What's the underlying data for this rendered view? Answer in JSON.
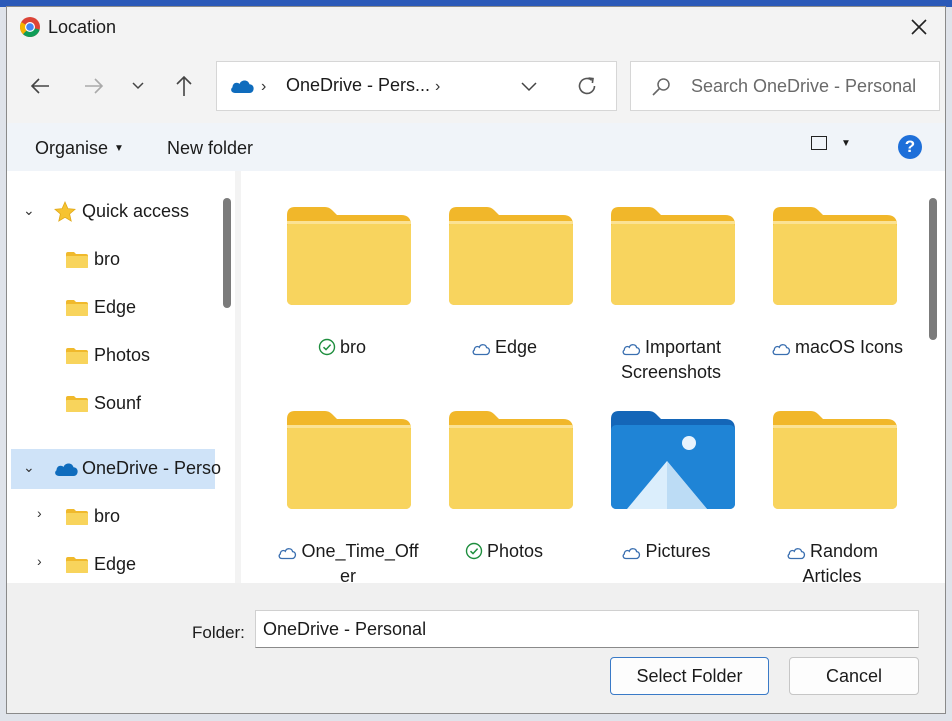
{
  "window": {
    "title": "Location",
    "close_icon": "close-icon",
    "app_icon": "chrome-icon"
  },
  "nav": {
    "back_icon": "arrow-left-icon",
    "forward_icon": "arrow-right-icon",
    "recent_icon": "chevron-down-icon",
    "up_icon": "arrow-up-icon"
  },
  "address": {
    "crumb": "OneDrive - Pers...",
    "chevron": "›"
  },
  "search": {
    "placeholder": "Search OneDrive - Personal"
  },
  "commands": {
    "organise": "Organise",
    "new_folder": "New folder"
  },
  "sidebar": {
    "quick_access": "Quick access",
    "quick_items": [
      {
        "label": "bro"
      },
      {
        "label": "Edge"
      },
      {
        "label": "Photos"
      },
      {
        "label": "Sounf"
      }
    ],
    "onedrive": "OneDrive - Perso",
    "onedrive_items": [
      {
        "label": "bro"
      },
      {
        "label": "Edge"
      }
    ]
  },
  "items": [
    {
      "name": "bro",
      "status": "synced"
    },
    {
      "name": "Edge",
      "status": "cloud"
    },
    {
      "name": "Important Screenshots",
      "status": "cloud"
    },
    {
      "name": "macOS Icons",
      "status": "cloud"
    },
    {
      "name": "One_Time_Offer",
      "status": "cloud"
    },
    {
      "name": "Photos",
      "status": "synced"
    },
    {
      "name": "Pictures",
      "status": "cloud",
      "kind": "pictures"
    },
    {
      "name": "Random Articles",
      "status": "cloud"
    }
  ],
  "footer": {
    "folder_label": "Folder:",
    "folder_value": "OneDrive - Personal",
    "select_button": "Select Folder",
    "cancel_button": "Cancel"
  },
  "colors": {
    "accent": "#1e6fd9",
    "selection": "#cfe3f8",
    "folder": "#f6cd4f"
  }
}
